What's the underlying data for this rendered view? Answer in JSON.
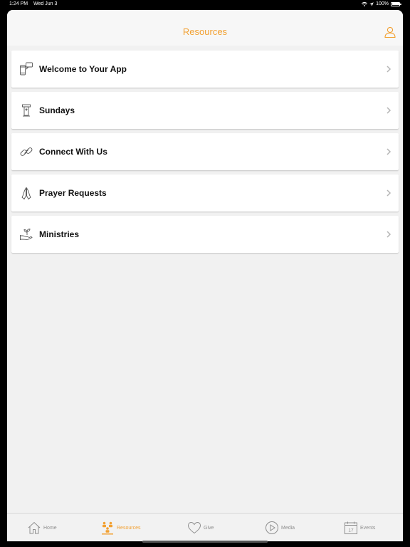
{
  "status_bar": {
    "time": "1:24 PM",
    "date": "Wed Jun 3",
    "battery": "100%"
  },
  "header": {
    "title": "Resources",
    "profile_icon": "person-icon"
  },
  "items": [
    {
      "label": "Welcome to Your App",
      "icon": "phone-chat-icon"
    },
    {
      "label": "Sundays",
      "icon": "pulpit-icon"
    },
    {
      "label": "Connect With Us",
      "icon": "link-icon"
    },
    {
      "label": "Prayer Requests",
      "icon": "praying-hands-icon"
    },
    {
      "label": "Ministries",
      "icon": "hand-plant-icon"
    }
  ],
  "tabs": [
    {
      "label": "Home",
      "icon": "house-icon",
      "active": false
    },
    {
      "label": "Resources",
      "icon": "people-icon",
      "active": true
    },
    {
      "label": "Give",
      "icon": "heart-icon",
      "active": false
    },
    {
      "label": "Media",
      "icon": "play-icon",
      "active": false
    },
    {
      "label": "Events",
      "icon": "calendar-icon",
      "active": false,
      "calendar_day": "17"
    }
  ],
  "colors": {
    "accent": "#f2a031",
    "inactive": "#8e8e8e",
    "background": "#f1f1f1"
  }
}
